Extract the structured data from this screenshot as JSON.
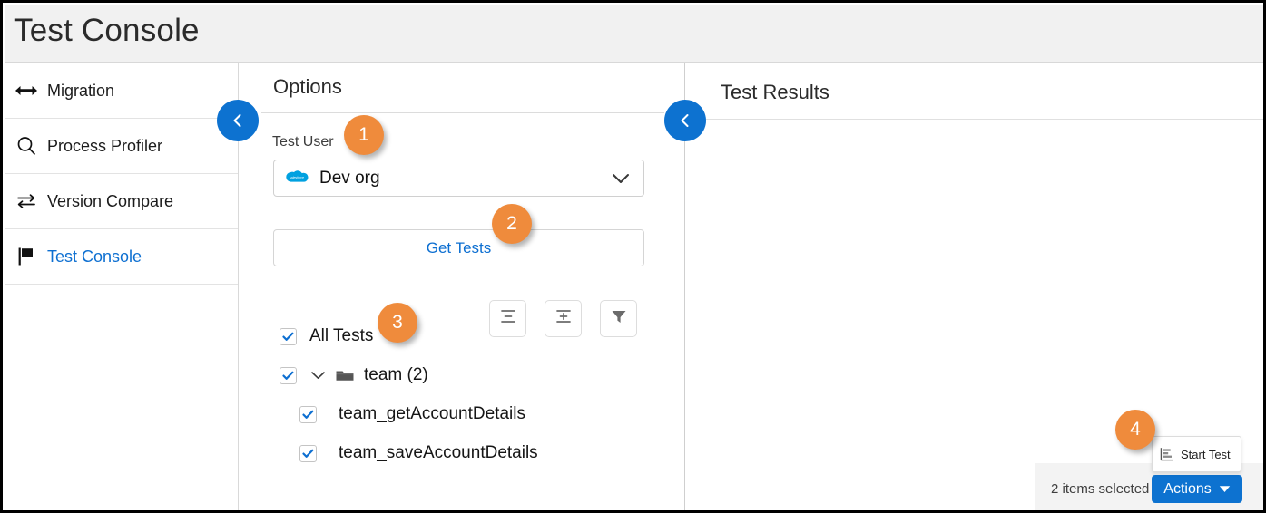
{
  "window": {
    "title": "Test Console"
  },
  "sidebar": {
    "items": [
      {
        "label": "Migration",
        "icon": "double-arrow-icon",
        "active": false
      },
      {
        "label": "Process Profiler",
        "icon": "search-icon",
        "active": false
      },
      {
        "label": "Version Compare",
        "icon": "swap-arrows-icon",
        "active": false
      },
      {
        "label": "Test Console",
        "icon": "flag-icon",
        "active": true
      }
    ]
  },
  "options_panel": {
    "title": "Options",
    "collapse_button": "collapse-left-icon",
    "test_user": {
      "label": "Test User",
      "selected": "Dev org",
      "org_icon": "salesforce-cloud-icon",
      "caret_icon": "chevron-down-icon"
    },
    "get_tests_button": "Get Tests",
    "toolbar": [
      {
        "name": "collapse-all-icon"
      },
      {
        "name": "expand-all-icon"
      },
      {
        "name": "filter-icon"
      }
    ],
    "tree": {
      "all_tests": {
        "label": "All Tests",
        "checked": true
      },
      "folder": {
        "label": "team (2)",
        "checked": true,
        "expanded": true,
        "icon": "folder-icon"
      },
      "tests": [
        {
          "label": "team_getAccountDetails",
          "checked": true
        },
        {
          "label": "team_saveAccountDetails",
          "checked": true
        }
      ]
    }
  },
  "results_panel": {
    "title": "Test Results",
    "collapse_button": "collapse-left-icon",
    "footer": {
      "items_selected": "2 items selected",
      "actions_label": "Actions",
      "actions_caret": "caret-down-icon"
    },
    "menu": {
      "item_label": "Start Test",
      "item_icon": "start-test-icon"
    }
  },
  "step_badges": [
    {
      "number": "1"
    },
    {
      "number": "2"
    },
    {
      "number": "3"
    },
    {
      "number": "4"
    }
  ],
  "colors": {
    "brand_blue": "#0d72d0",
    "link_blue": "#0d6fd1",
    "badge_orange": "#ef8b3c",
    "header_grey": "#f1f1f1",
    "footer_grey": "#f3f3f3"
  }
}
